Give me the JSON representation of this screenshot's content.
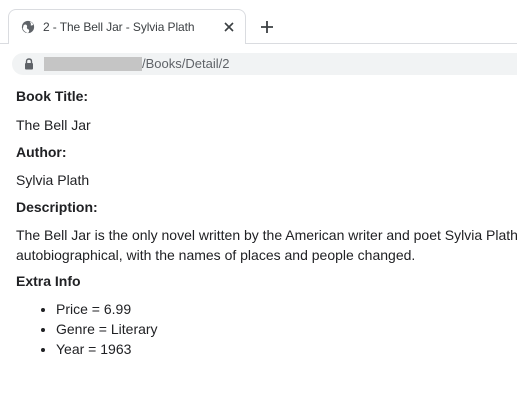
{
  "browser": {
    "tab_title": "2 - The Bell Jar - Sylvia Plath",
    "url_path": "/Books/Detail/2",
    "icons": {
      "favicon": "globe-icon",
      "close": "close-icon",
      "new_tab": "plus-icon",
      "lock": "lock-icon"
    },
    "colors": {
      "address_bar_bg": "#f1f3f4",
      "url_mask": "#c5c5c5"
    }
  },
  "book": {
    "title_label": "Book Title:",
    "title": "The Bell Jar",
    "author_label": "Author:",
    "author": "Sylvia Plath",
    "description_label": "Description:",
    "description_line1": "The Bell Jar is the only novel written by the American writer and poet Sylvia Plath",
    "description_line2": "autobiographical, with the names of places and people changed.",
    "extra_label": "Extra Info",
    "extra_items": [
      "Price = 6.99",
      "Genre = Literary",
      "Year = 1963"
    ]
  }
}
